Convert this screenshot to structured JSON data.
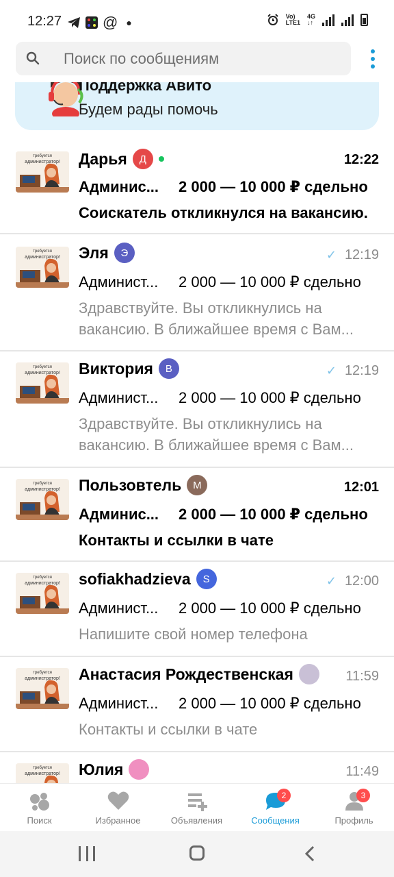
{
  "status_bar": {
    "time": "12:27",
    "left_icons": [
      "telegram-icon",
      "app-icon",
      "at-icon",
      "dot-icon"
    ],
    "right_icons": [
      "alarm-icon",
      "volte-icon",
      "4g-icon",
      "signal-icon",
      "signal-icon",
      "battery-icon"
    ],
    "network_label": "4G"
  },
  "search": {
    "placeholder": "Поиск по сообщениям"
  },
  "support": {
    "title": "Поддержка Авито",
    "subtitle": "Будем рады помочь"
  },
  "thumb_text": "требуется администратор!",
  "chats": [
    {
      "name": "Дарья",
      "badge": "Д",
      "badge_color": "#e54848",
      "online": true,
      "time": "12:22",
      "unread": true,
      "read_check": false,
      "title": "Админис...",
      "price": "2 000 — 10 000 ₽ сдельно",
      "message": "Соискатель откликнулся на вакансию."
    },
    {
      "name": "Эля",
      "badge": "Э",
      "badge_color": "#5a5fc2",
      "online": false,
      "time": "12:19",
      "unread": false,
      "read_check": true,
      "title": "Админист...",
      "price": "2 000 — 10 000 ₽ сдельно",
      "message": "Здравствуйте. Вы откликнулись на вакансию. В ближайшее время с Вам..."
    },
    {
      "name": "Виктория",
      "badge": "В",
      "badge_color": "#5a5fc2",
      "online": false,
      "time": "12:19",
      "unread": false,
      "read_check": true,
      "title": "Админист...",
      "price": "2 000 — 10 000 ₽ сдельно",
      "message": "Здравствуйте. Вы откликнулись на вакансию. В ближайшее время с Вам..."
    },
    {
      "name": "Пользовтель",
      "badge": "М",
      "badge_color": "#8a6a5b",
      "online": false,
      "time": "12:01",
      "unread": true,
      "read_check": false,
      "title": "Админис...",
      "price": "2 000 — 10 000 ₽ сдельно",
      "message": "Контакты и ссылки в чате"
    },
    {
      "name": "sofiakhadzieva",
      "badge": "S",
      "badge_color": "#4466dd",
      "online": false,
      "time": "12:00",
      "unread": false,
      "read_check": true,
      "title": "Админист...",
      "price": "2 000 — 10 000 ₽ сдельно",
      "message": "Напишите свой номер телефона"
    },
    {
      "name": "Анастасия Рождественская",
      "badge": "",
      "badge_color": "#c9c0d6",
      "online": false,
      "time": "11:59",
      "unread": false,
      "read_check": false,
      "title": "Админист...",
      "price": "2 000 — 10 000 ₽ сдельно",
      "message": "Контакты и ссылки в чате"
    },
    {
      "name": "Юлия",
      "badge": "",
      "badge_color": "#f08fc0",
      "online": false,
      "time": "11:49",
      "unread": false,
      "read_check": false,
      "title": "",
      "price": "",
      "message": ""
    }
  ],
  "nav": {
    "items": [
      {
        "label": "Поиск",
        "icon": "search-dots-icon",
        "badge": ""
      },
      {
        "label": "Избранное",
        "icon": "heart-icon",
        "badge": ""
      },
      {
        "label": "Объявления",
        "icon": "add-listing-icon",
        "badge": ""
      },
      {
        "label": "Сообщения",
        "icon": "chat-icon",
        "badge": "2"
      },
      {
        "label": "Профиль",
        "icon": "profile-icon",
        "badge": "3"
      }
    ],
    "active_index": 3,
    "accent_color": "#1a9bd7"
  }
}
